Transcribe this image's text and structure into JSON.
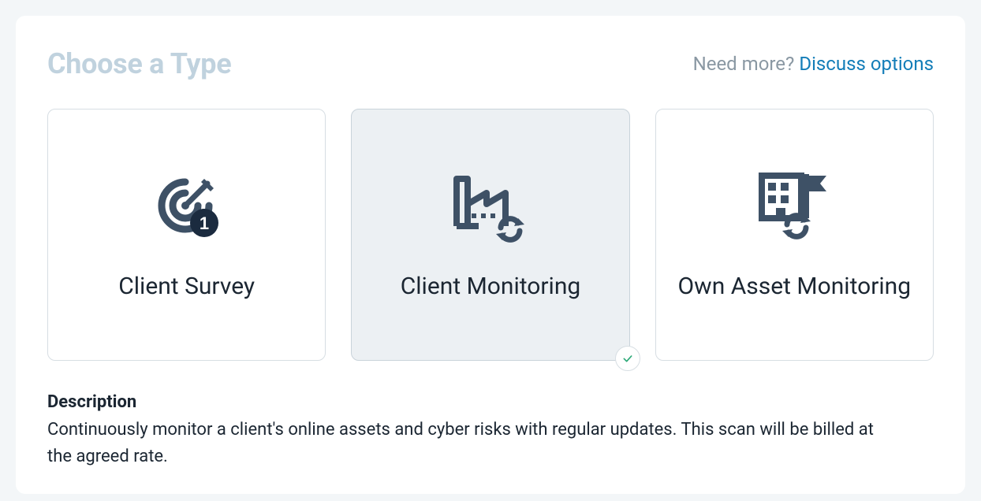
{
  "header": {
    "title": "Choose a Type",
    "help_prefix": "Need more? ",
    "help_link": "Discuss options"
  },
  "cards": [
    {
      "label": "Client Survey",
      "badge_number": "1",
      "selected": false
    },
    {
      "label": "Client Monitoring",
      "selected": true
    },
    {
      "label": "Own Asset Monitoring",
      "selected": false
    }
  ],
  "description": {
    "heading": "Description",
    "text": "Continuously monitor a client's online assets and cyber risks with regular updates. This scan will be billed at the agreed rate."
  }
}
